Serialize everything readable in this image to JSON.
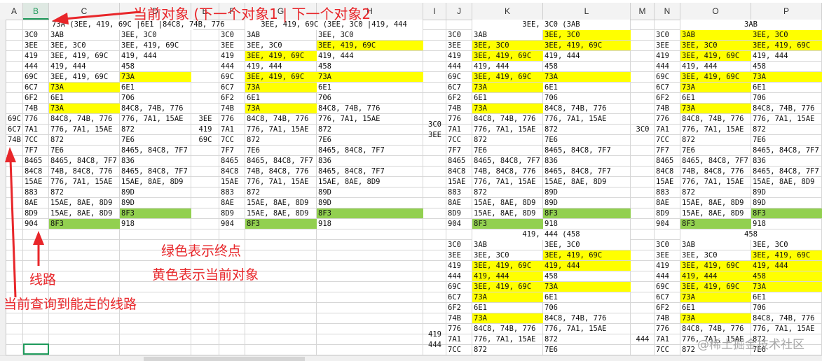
{
  "sheet": {
    "columns": [
      "A",
      "B",
      "C",
      "D",
      "E",
      "F",
      "G",
      "H",
      "I",
      "J",
      "K",
      "L",
      "M",
      "N",
      "O",
      "P"
    ],
    "selected_column": "B"
  },
  "rows": [
    [
      "3C0",
      "3AB",
      "3EE, 3C0"
    ],
    [
      "3EE",
      "3EE, 3C0",
      "3EE, 419, 69C"
    ],
    [
      "419",
      "3EE, 419, 69C",
      "419, 444"
    ],
    [
      "444",
      "419, 444",
      "458"
    ],
    [
      "69C",
      "3EE, 419, 69C",
      "73A"
    ],
    [
      "6C7",
      "73A",
      "6E1"
    ],
    [
      "6F2",
      "6E1",
      "706"
    ],
    [
      "74B",
      "73A",
      "84C8, 74B, 776"
    ],
    [
      "776",
      "84C8, 74B, 776",
      "776, 7A1, 15AE"
    ],
    [
      "7A1",
      "776, 7A1, 15AE",
      "872"
    ],
    [
      "7CC",
      "872",
      "7E6"
    ],
    [
      "7F7",
      "7E6",
      "8465, 84C8, 7F7"
    ],
    [
      "8465",
      "8465, 84C8, 7F7",
      "836"
    ],
    [
      "84C8",
      "74B, 84C8, 776",
      "8465, 84C8, 7F7"
    ],
    [
      "15AE",
      "776, 7A1, 15AE",
      "15AE, 8AE, 8D9"
    ],
    [
      "883",
      "872",
      "89D"
    ],
    [
      "8AE",
      "15AE, 8AE, 8D9",
      "89D"
    ],
    [
      "8D9",
      "15AE, 8AE, 8D9",
      "8F3"
    ],
    [
      "904",
      "8F3",
      "918"
    ]
  ],
  "blocks": [
    {
      "title": "73A (3EE, 419, 69C |6E1 |84C8, 74B, 776",
      "side_labels": [
        "69C",
        "6C7",
        "74B"
      ],
      "yellow": [
        [
          4,
          2
        ],
        [
          5,
          1
        ],
        [
          7,
          1
        ]
      ],
      "green": [
        [
          17,
          2
        ],
        [
          18,
          1
        ]
      ]
    },
    {
      "title": "3EE, 419, 69C (3EE, 3C0 |419, 444",
      "side_labels": [
        "3EE",
        "419",
        "69C"
      ],
      "yellow": [
        [
          1,
          2
        ],
        [
          2,
          1
        ],
        [
          4,
          1
        ],
        [
          4,
          2
        ],
        [
          5,
          1
        ],
        [
          7,
          1
        ]
      ],
      "green": [
        [
          17,
          2
        ],
        [
          18,
          1
        ]
      ]
    },
    {
      "title": "3EE, 3C0 (3AB",
      "side_labels": [
        "3C0",
        "3EE"
      ],
      "yellow": [
        [
          0,
          2
        ],
        [
          1,
          1
        ],
        [
          1,
          2
        ],
        [
          2,
          1
        ],
        [
          4,
          1
        ],
        [
          4,
          2
        ],
        [
          5,
          1
        ],
        [
          7,
          1
        ]
      ],
      "green": [
        [
          17,
          2
        ],
        [
          18,
          1
        ]
      ]
    },
    {
      "title": "3AB",
      "side_labels": [
        "3C0"
      ],
      "yellow": [
        [
          0,
          1
        ],
        [
          0,
          2
        ],
        [
          1,
          1
        ],
        [
          1,
          2
        ],
        [
          2,
          1
        ],
        [
          4,
          1
        ],
        [
          4,
          2
        ],
        [
          5,
          1
        ],
        [
          7,
          1
        ]
      ],
      "green": [
        [
          17,
          2
        ],
        [
          18,
          1
        ]
      ]
    },
    {
      "title": "419, 444 (458",
      "side_labels": [
        "419",
        "444"
      ],
      "yellow": [
        [
          1,
          2
        ],
        [
          2,
          1
        ],
        [
          2,
          2
        ],
        [
          3,
          1
        ],
        [
          4,
          1
        ],
        [
          4,
          2
        ],
        [
          5,
          1
        ],
        [
          7,
          1
        ]
      ],
      "green": []
    },
    {
      "title": "458",
      "side_labels": [
        "444"
      ],
      "yellow": [
        [
          1,
          2
        ],
        [
          2,
          1
        ],
        [
          2,
          2
        ],
        [
          3,
          1
        ],
        [
          3,
          2
        ],
        [
          4,
          1
        ],
        [
          4,
          2
        ],
        [
          5,
          1
        ],
        [
          7,
          1
        ]
      ],
      "green": []
    }
  ],
  "annotations": {
    "header_note": "当前对象 (下一个对象1 | 下一个对象2",
    "green_note": "绿色表示终点",
    "yellow_note": "黄色表示当前对象",
    "route_note": "线路",
    "query_note": "当前查询到能走的线路"
  },
  "watermark": "@稀土掘金技术社区",
  "colors": {
    "yellow": "#ffff00",
    "green": "#92d050",
    "annotation": "#e8262a"
  }
}
